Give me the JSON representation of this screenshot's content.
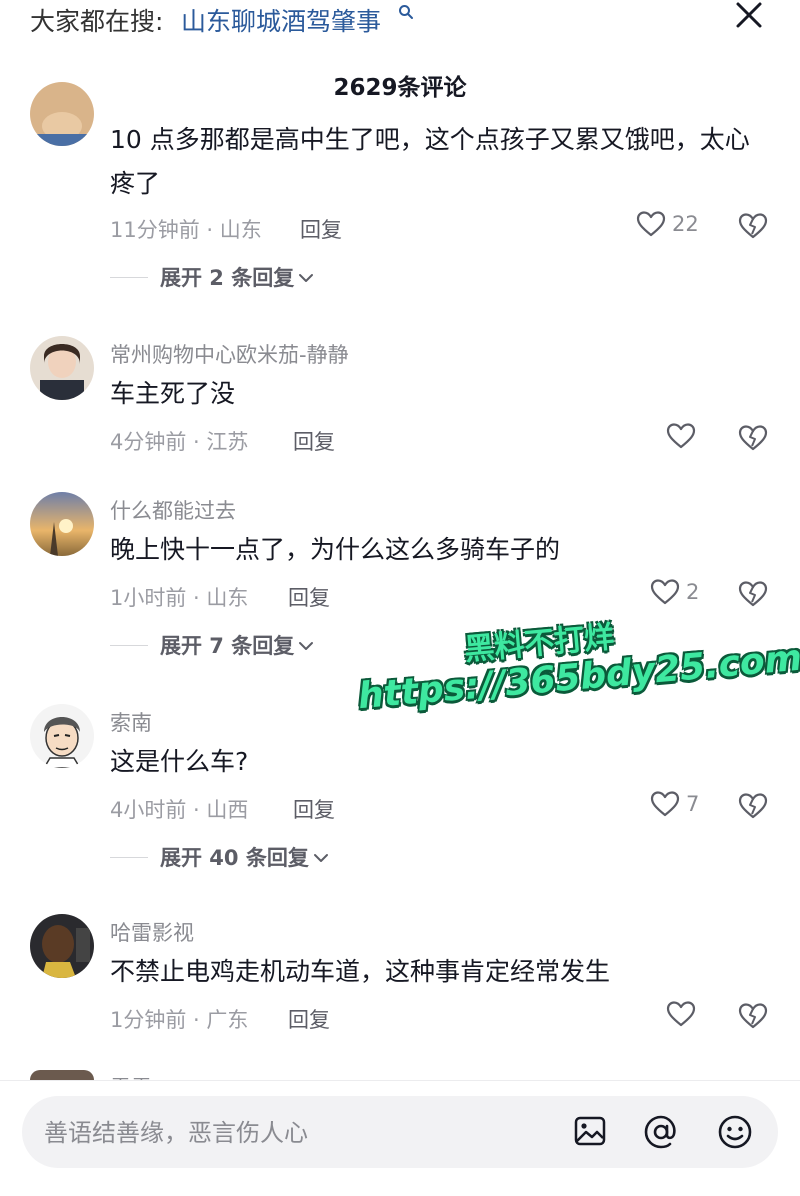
{
  "search": {
    "prefix": "大家都在搜:",
    "term": "山东聊城酒驾肇事"
  },
  "header": {
    "comment_count": "2629条评论"
  },
  "comments": [
    {
      "username": "",
      "text": "10 点多那都是高中生了吧，这个点孩子又累又饿吧，太心疼了",
      "time_location": "11分钟前 · 山东",
      "reply_label": "回复",
      "likes": "22",
      "expand_label": "展开 2 条回复"
    },
    {
      "username": "常州购物中心欧米茄-静静",
      "text": "车主死了没",
      "time_location": "4分钟前 · 江苏",
      "reply_label": "回复",
      "likes": ""
    },
    {
      "username": "什么都能过去",
      "text": "晚上快十一点了，为什么这么多骑车子的",
      "time_location": "1小时前 · 山东",
      "reply_label": "回复",
      "likes": "2",
      "expand_label": "展开 7 条回复"
    },
    {
      "username": "索南",
      "text": "这是什么车?",
      "time_location": "4小时前 · 山西",
      "reply_label": "回复",
      "likes": "7",
      "expand_label": "展开 40 条回复"
    },
    {
      "username": "哈雷影视",
      "text": "不禁止电鸡走机动车道，这种事肯定经常发生",
      "time_location": "1分钟前 · 广东",
      "reply_label": "回复",
      "likes": ""
    },
    {
      "username": "雷雷"
    }
  ],
  "watermark": {
    "line1": "黑料不打烊",
    "line2": "https://365bdy25.com"
  },
  "composer": {
    "placeholder": "善语结善缘，恶言伤人心"
  },
  "icons": [
    "search-icon",
    "close-icon",
    "heart-icon",
    "dislike-heart-icon",
    "chevron-down-icon",
    "image-icon",
    "at-icon",
    "emoji-icon"
  ],
  "colors": {
    "search_term": "#2b5a9b",
    "watermark_fill": "#3ee8a0",
    "watermark_outline": "#0b5a3a"
  }
}
